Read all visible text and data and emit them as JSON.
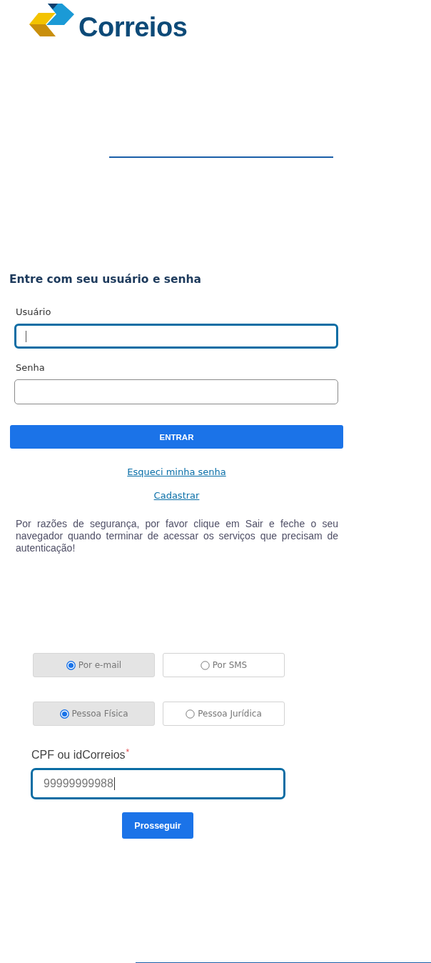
{
  "logo": {
    "text": "Correios"
  },
  "login": {
    "title": "Entre com seu usuário e senha",
    "fields": [
      {
        "label": "Usuário",
        "focused": true
      },
      {
        "label": "Senha",
        "focused": false
      }
    ],
    "submit": "ENTRAR",
    "links": [
      "Esqueci minha senha",
      "Cadastrar"
    ],
    "notice": "Por razões de segurança, por favor clique em Sair e feche o seu navegador quando terminar de acessar os serviços que precisam de autenticação!"
  },
  "recovery": {
    "channel_options": [
      {
        "label": "Por e-mail",
        "selected": true
      },
      {
        "label": "Por SMS",
        "selected": false
      }
    ],
    "person_options": [
      {
        "label": "Pessoa Física",
        "selected": true
      },
      {
        "label": "Pessoa Jurídica",
        "selected": false
      }
    ],
    "id_field": {
      "label": "CPF ou idCorreios",
      "required_mark": "*",
      "value": "99999999988",
      "focused": true
    },
    "submit": "Prosseguir"
  }
}
